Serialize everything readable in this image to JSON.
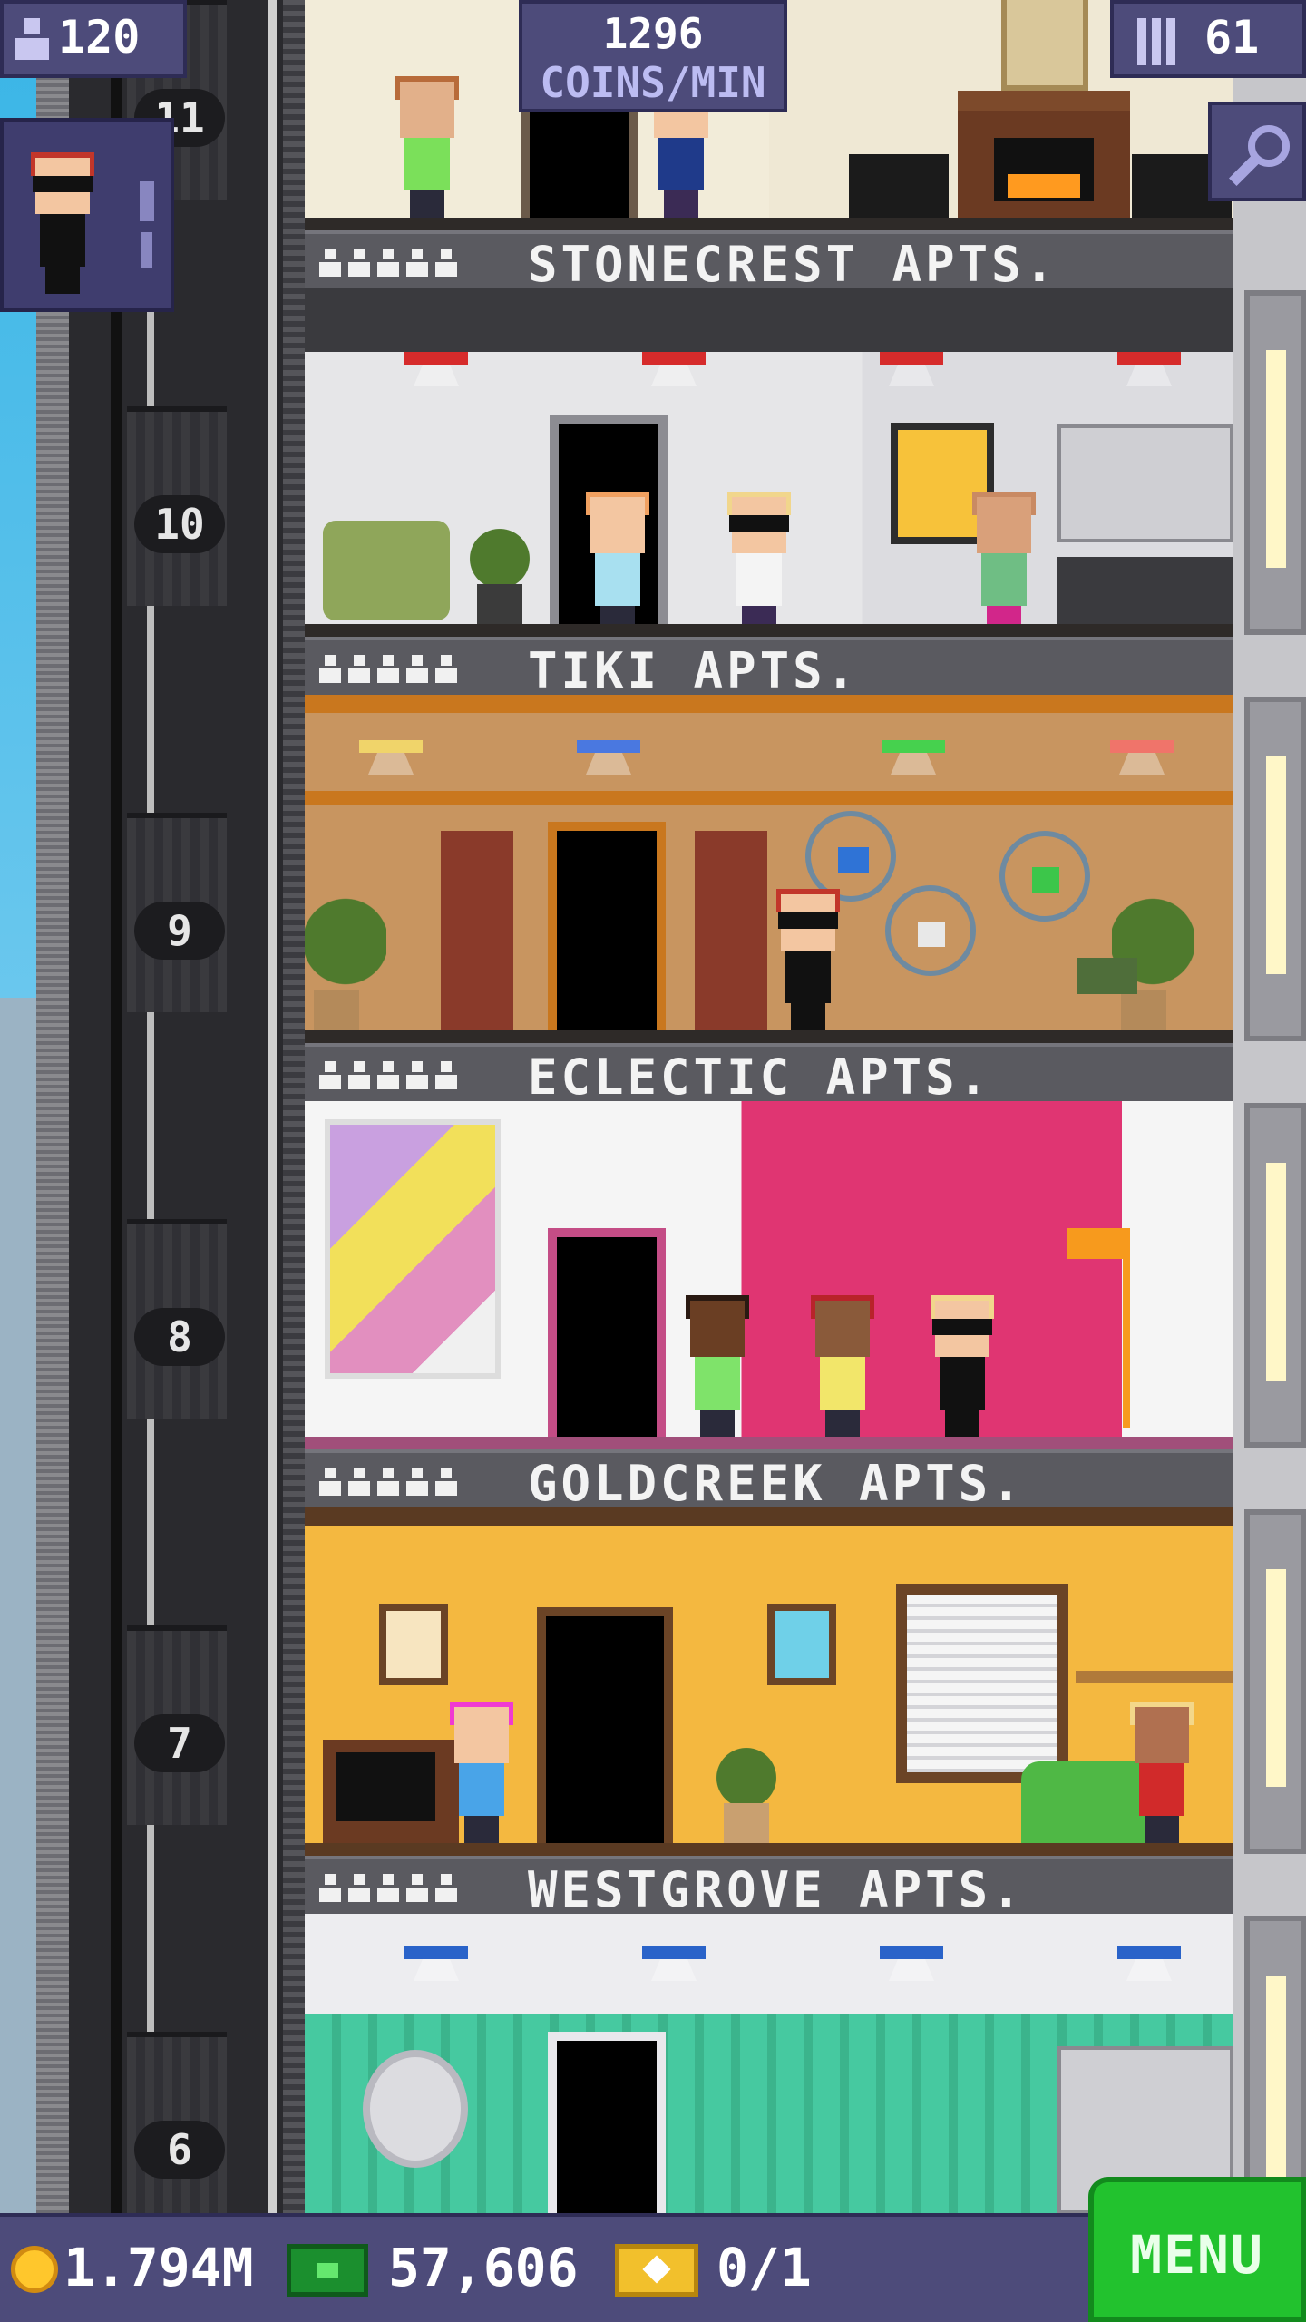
{
  "hud": {
    "population": "120",
    "coins_per_min_value": "1296",
    "coins_per_min_label": "COINS/MIN",
    "floors_count": "61"
  },
  "shaft": {
    "floor_numbers": [
      "11",
      "10",
      "9",
      "8",
      "7",
      "6"
    ]
  },
  "floors": [
    {
      "name": "STONECREST APTS."
    },
    {
      "name": "TIKI APTS."
    },
    {
      "name": "ECLECTIC APTS."
    },
    {
      "name": "GOLDCREEK APTS."
    },
    {
      "name": "WESTGROVE APTS."
    }
  ],
  "bottom_bar": {
    "coins": "1.794M",
    "bux": "57,606",
    "tickets": "0/1",
    "menu_label": "MENU"
  },
  "icons": {
    "population": "person-icon",
    "floors": "building-icon",
    "search": "magnifier-icon",
    "coins": "coin-icon",
    "bux": "bux-icon",
    "tickets": "ticket-icon"
  },
  "colors": {
    "hud_bg": "#4d4b7a",
    "menu_green": "#22c22e",
    "coin_gold": "#ffc72c",
    "bux_green": "#1b8f2e"
  }
}
